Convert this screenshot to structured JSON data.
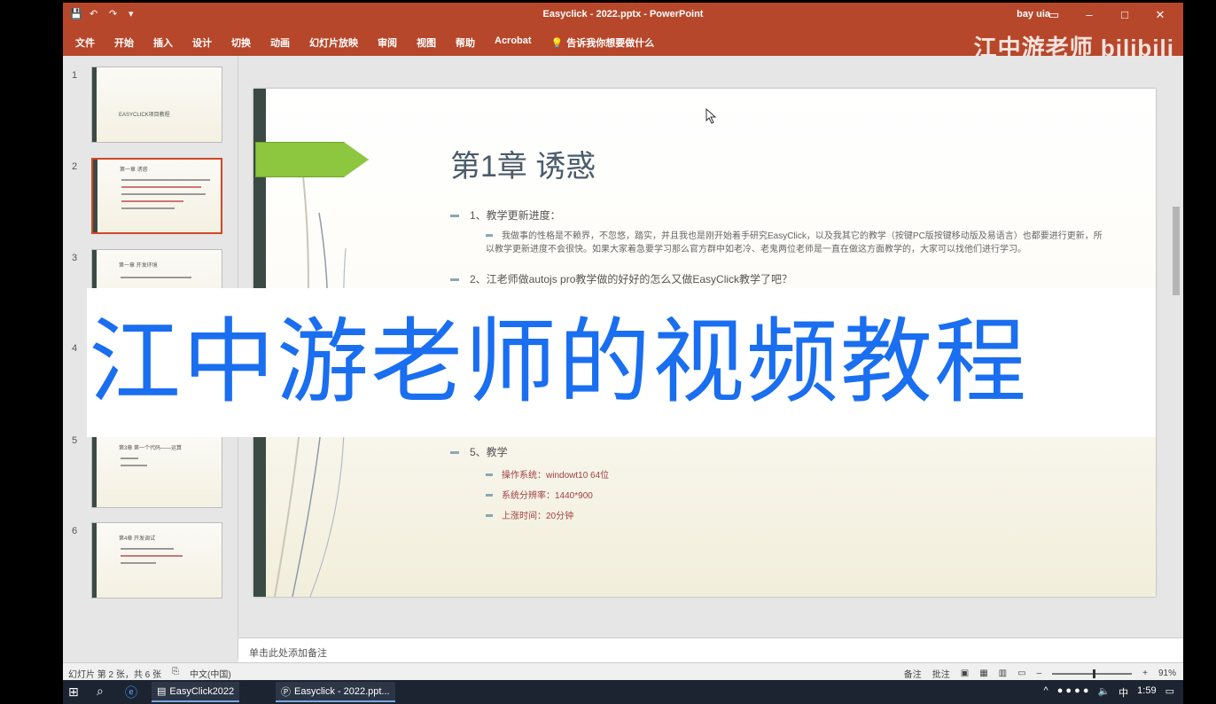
{
  "window": {
    "doc_title": "Easyclick - 2022.pptx - PowerPoint",
    "user": "bay uia",
    "controls": [
      "▭",
      "–",
      "□",
      "✕"
    ]
  },
  "ribbon": {
    "tabs": [
      "文件",
      "开始",
      "插入",
      "设计",
      "切换",
      "动画",
      "幻灯片放映",
      "审阅",
      "视图",
      "帮助",
      "Acrobat"
    ],
    "tell_me": "告诉我你想要做什么",
    "watermark": "江中游老师 bilibili"
  },
  "thumbnails": [
    {
      "num": "1",
      "text": "EASYCLICK项目教程"
    },
    {
      "num": "2",
      "text": "第一章 诱惑"
    },
    {
      "num": "3",
      "text": "第一章 开发环境"
    },
    {
      "num": "4",
      "text": ""
    },
    {
      "num": "5",
      "text": "第3章 第一个代码——运算"
    },
    {
      "num": "6",
      "text": "第4章 开发调试"
    }
  ],
  "slide": {
    "title": "第1章 诱惑",
    "b1": "1、教学更新进度：",
    "b1_sub": "我做事的性格是不赖界，不忽悠，踏实，并且我也是刚开始着手研究EasyClick，以及我其它的教学（按键PC版按键移动版及易语言）也都要进行更新，所以教学更新进度不会很快。如果大家着急要学习那么官方群中如老冷、老鬼两位老师是一直在做这方面教学的，大家可以找他们进行学习。",
    "b2": "2、江老师做autojs pro教学做的好好的怎么又做EasyClick教学了吧？",
    "b5": "5、教学",
    "s1": "操作系统：windowt10 64位",
    "s2": "系统分辨率：1440*900",
    "s3": "上涨时间：20分钟"
  },
  "overlay": "江中游老师的视频教程",
  "notes_placeholder": "单击此处添加备注",
  "status": {
    "slide_info": "幻灯片 第 2 张，共 6 张",
    "language": "中文(中国)",
    "notes_btn": "备注",
    "comments_btn": "批注",
    "zoom": "91%"
  },
  "taskbar": {
    "apps": [
      "EasyClick2022",
      "Easyclick - 2022.ppt..."
    ],
    "time": "1:59",
    "ime": "中"
  }
}
